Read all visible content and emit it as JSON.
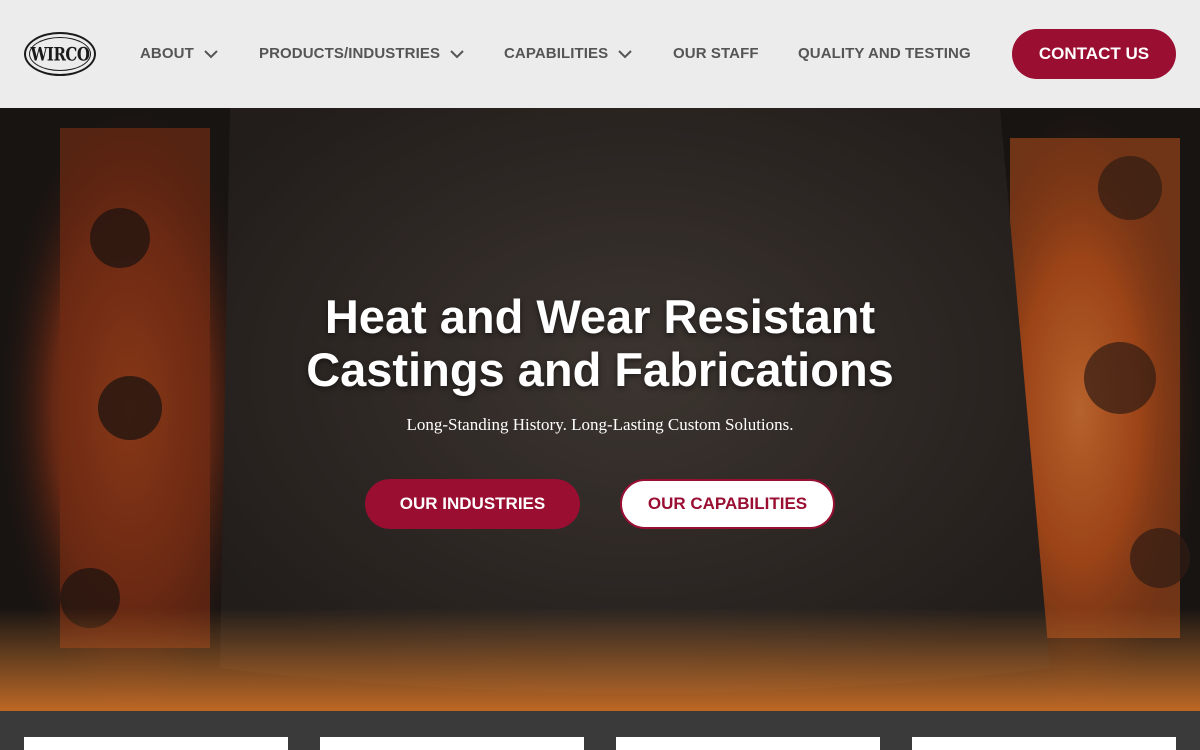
{
  "header": {
    "logo_text": "WIRCO",
    "nav": [
      {
        "label": "ABOUT",
        "has_dropdown": true
      },
      {
        "label": "PRODUCTS/INDUSTRIES",
        "has_dropdown": true
      },
      {
        "label": "CAPABILITIES",
        "has_dropdown": true
      },
      {
        "label": "OUR STAFF",
        "has_dropdown": false
      },
      {
        "label": "QUALITY AND TESTING",
        "has_dropdown": false
      }
    ],
    "contact_label": "CONTACT US"
  },
  "hero": {
    "title_line1": "Heat and Wear Resistant",
    "title_line2": "Castings and Fabrications",
    "subtitle": "Long-Standing History. Long-Lasting Custom Solutions.",
    "primary_button": "OUR INDUSTRIES",
    "secondary_button": "OUR CAPABILITIES"
  },
  "colors": {
    "brand": "#9a0e32",
    "header_bg": "#ececec",
    "nav_text": "#555555",
    "footer_strip": "#3a3a3a"
  },
  "icons": {
    "dropdown": "chevron-down-icon"
  }
}
